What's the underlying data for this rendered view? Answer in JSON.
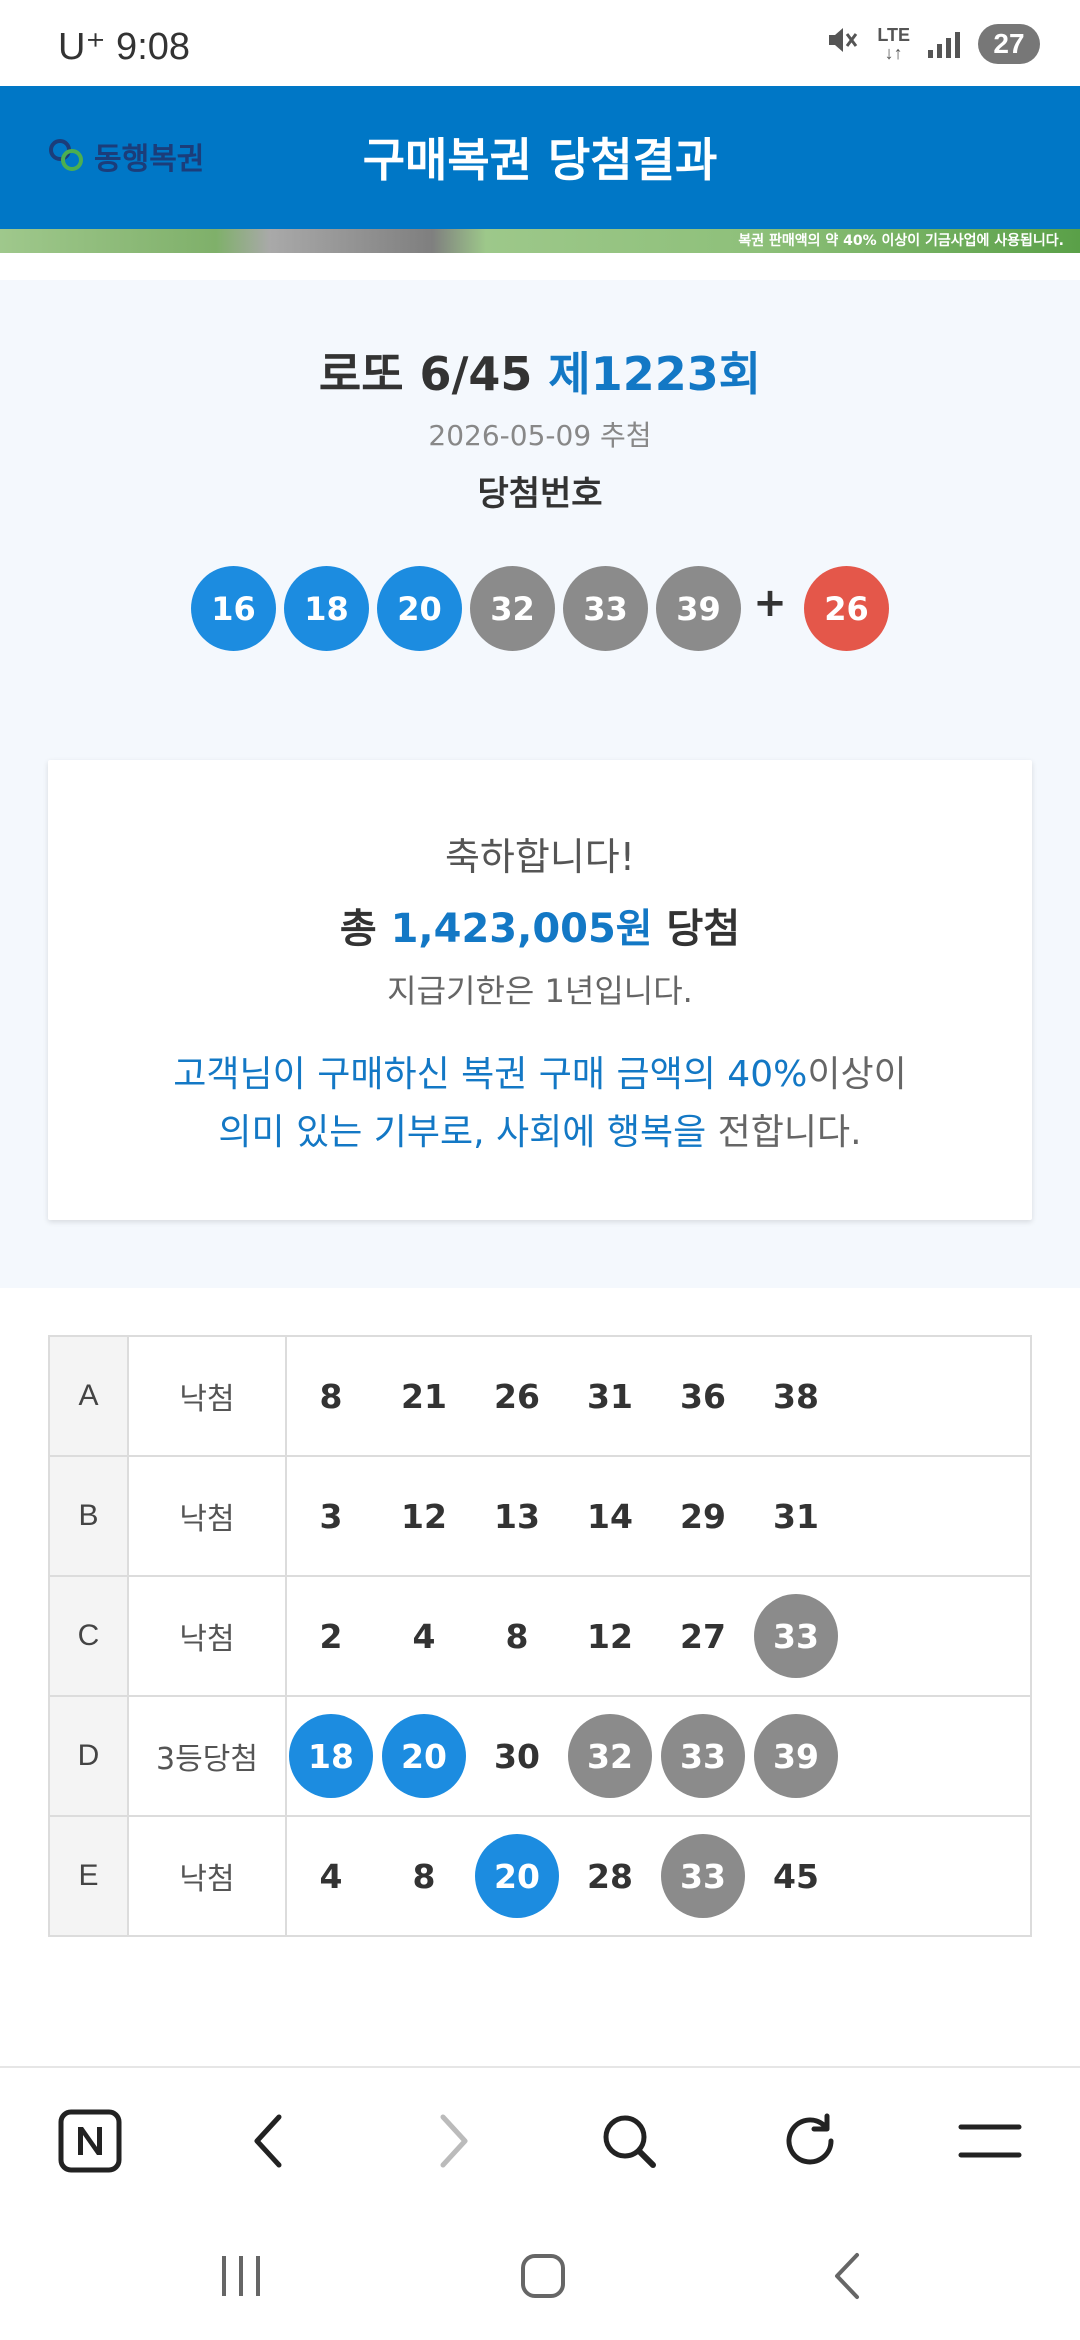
{
  "status_bar": {
    "carrier_time": "U⁺ 9:08",
    "network": "LTE",
    "battery": "27"
  },
  "header": {
    "logo_text": "동행복권",
    "title": "구매복권 당첨결과"
  },
  "banner": {
    "text": "복권 판매액의 약 40% 이상이 기금사업에 사용됩니다."
  },
  "draw": {
    "game": "로또 6/45",
    "round": "제1223회",
    "date": "2026-05-09 추첨",
    "numbers_label": "당첨번호",
    "winning_numbers": [
      "16",
      "18",
      "20",
      "32",
      "33",
      "39"
    ],
    "bonus_plus": "+",
    "bonus_number": "26"
  },
  "congrats": {
    "title": "축하합니다!",
    "prize_prefix": "총",
    "prize_amount": "1,423,005원",
    "prize_suffix": "당첨",
    "deadline": "지급기한은 1년입니다.",
    "donation_line1_hl": "고객님이 구매하신 복권 구매 금액의 40%",
    "donation_line1_rest": "이상이",
    "donation_line2_hl": "의미 있는 기부로, 사회에 행복을",
    "donation_line2_rest": " 전합니다."
  },
  "ticket": {
    "rows": [
      {
        "slot": "A",
        "result": "낙첨",
        "numbers": [
          {
            "n": "8",
            "s": "plain"
          },
          {
            "n": "21",
            "s": "plain"
          },
          {
            "n": "26",
            "s": "plain"
          },
          {
            "n": "31",
            "s": "plain"
          },
          {
            "n": "36",
            "s": "plain"
          },
          {
            "n": "38",
            "s": "plain"
          }
        ]
      },
      {
        "slot": "B",
        "result": "낙첨",
        "numbers": [
          {
            "n": "3",
            "s": "plain"
          },
          {
            "n": "12",
            "s": "plain"
          },
          {
            "n": "13",
            "s": "plain"
          },
          {
            "n": "14",
            "s": "plain"
          },
          {
            "n": "29",
            "s": "plain"
          },
          {
            "n": "31",
            "s": "plain"
          }
        ]
      },
      {
        "slot": "C",
        "result": "낙첨",
        "numbers": [
          {
            "n": "2",
            "s": "plain"
          },
          {
            "n": "4",
            "s": "plain"
          },
          {
            "n": "8",
            "s": "plain"
          },
          {
            "n": "12",
            "s": "plain"
          },
          {
            "n": "27",
            "s": "plain"
          },
          {
            "n": "33",
            "s": "gray"
          }
        ]
      },
      {
        "slot": "D",
        "result": "3등당첨",
        "numbers": [
          {
            "n": "18",
            "s": "blue"
          },
          {
            "n": "20",
            "s": "blue"
          },
          {
            "n": "30",
            "s": "plain"
          },
          {
            "n": "32",
            "s": "gray"
          },
          {
            "n": "33",
            "s": "gray"
          },
          {
            "n": "39",
            "s": "gray"
          }
        ]
      },
      {
        "slot": "E",
        "result": "낙첨",
        "numbers": [
          {
            "n": "4",
            "s": "plain"
          },
          {
            "n": "8",
            "s": "plain"
          },
          {
            "n": "20",
            "s": "blue"
          },
          {
            "n": "28",
            "s": "plain"
          },
          {
            "n": "33",
            "s": "gray"
          },
          {
            "n": "45",
            "s": "plain"
          }
        ]
      }
    ]
  },
  "browser_toolbar": {
    "icons": [
      "naver-home-icon",
      "back-icon",
      "forward-icon",
      "search-icon",
      "refresh-icon",
      "menu-icon"
    ]
  },
  "colors": {
    "header_blue": "#0077c6",
    "accent_blue": "#1378c5",
    "ball_blue": "#1c8ce0",
    "ball_gray": "#8b8b8b",
    "ball_red": "#e4574a"
  }
}
